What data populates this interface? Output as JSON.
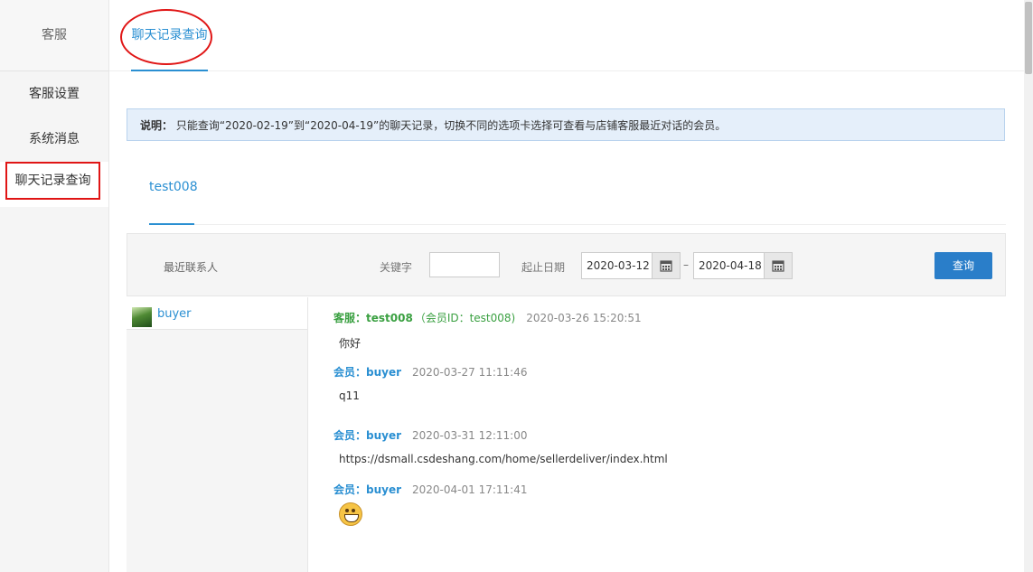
{
  "sidebar": {
    "header": "客服",
    "items": [
      {
        "label": "客服设置"
      },
      {
        "label": "系统消息"
      },
      {
        "label": "聊天记录查询"
      }
    ]
  },
  "topbar": {
    "active_tab": "聊天记录查询"
  },
  "notice": {
    "prefix": "说明：",
    "text": "只能查询“2020-02-19”到“2020-04-19”的聊天记录，切换不同的选项卡选择可查看与店铺客服最近对话的会员。"
  },
  "subtab": {
    "label": "test008"
  },
  "filter": {
    "recent_label": "最近联系人",
    "keyword_label": "关键字",
    "keyword_value": "",
    "date_label": "起止日期",
    "date_start": "2020-03-12",
    "date_end": "2020-04-18",
    "date_sep": "–",
    "query_label": "查询"
  },
  "contacts": [
    {
      "name": "buyer"
    }
  ],
  "messages": [
    {
      "sender": "客服：test008",
      "meta": "（会员ID：test008)",
      "time": "2020-03-26 15:20:51",
      "content": "你好"
    },
    {
      "sender": "会员：buyer",
      "meta": "",
      "time": "2020-03-27 11:11:46",
      "content": "q11"
    },
    {
      "sender": "会员：buyer",
      "meta": "",
      "time": "2020-03-31 12:11:00",
      "content": "https://dsmall.csdeshang.com/home/sellerdeliver/index.html"
    },
    {
      "sender": "会员：buyer",
      "meta": "",
      "time": "2020-04-01 17:11:41",
      "content": "",
      "emoji": "grinning-emoji"
    }
  ],
  "colors": {
    "accent": "#2a8fd2",
    "highlight": "#e01515",
    "staff": "#3aa041",
    "button": "#2a7ec9"
  }
}
